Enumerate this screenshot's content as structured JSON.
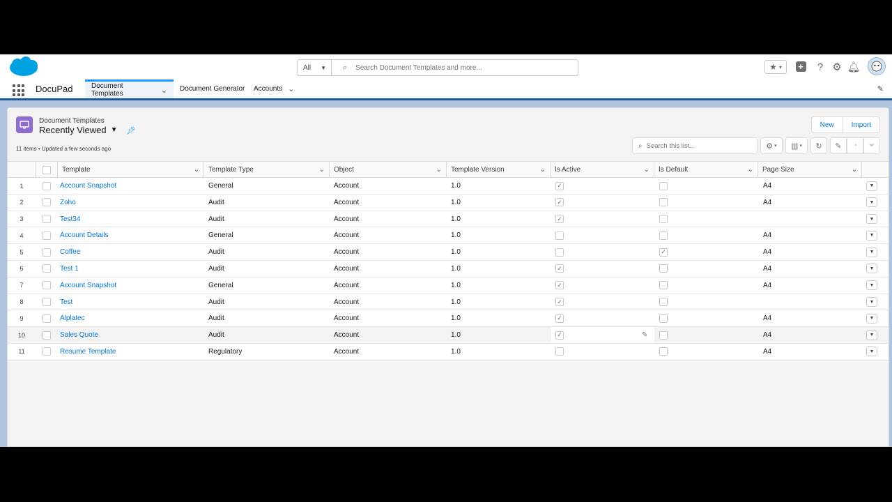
{
  "search": {
    "scope": "All",
    "placeholder": "Search Document Templates and more..."
  },
  "nav": {
    "app_name": "DocuPad",
    "tabs": [
      {
        "label": "Document Templates",
        "active": true
      },
      {
        "label": "Document Generator",
        "active": false
      },
      {
        "label": "Accounts",
        "active": false
      }
    ]
  },
  "list": {
    "object_label": "Document Templates",
    "view_name": "Recently Viewed",
    "meta": "11 items • Updated a few seconds ago",
    "search_placeholder": "Search this list...",
    "buttons": {
      "new": "New",
      "import": "Import"
    },
    "columns": [
      "Template",
      "Template Type",
      "Object",
      "Template Version",
      "Is Active",
      "Is Default",
      "Page Size"
    ],
    "rows": [
      {
        "n": "1",
        "template": "Account Snapshot",
        "type": "General",
        "object": "Account",
        "version": "1.0",
        "active": true,
        "default": false,
        "size": "A4"
      },
      {
        "n": "2",
        "template": "Zoho",
        "type": "Audit",
        "object": "Account",
        "version": "1.0",
        "active": true,
        "default": false,
        "size": "A4"
      },
      {
        "n": "3",
        "template": "Test34",
        "type": "Audit",
        "object": "Account",
        "version": "1.0",
        "active": true,
        "default": false,
        "size": ""
      },
      {
        "n": "4",
        "template": "Account Details",
        "type": "General",
        "object": "Account",
        "version": "1.0",
        "active": false,
        "default": false,
        "size": "A4"
      },
      {
        "n": "5",
        "template": "Coffee",
        "type": "Audit",
        "object": "Account",
        "version": "1.0",
        "active": false,
        "default": true,
        "size": "A4"
      },
      {
        "n": "6",
        "template": "Test 1",
        "type": "Audit",
        "object": "Account",
        "version": "1.0",
        "active": true,
        "default": false,
        "size": "A4"
      },
      {
        "n": "7",
        "template": "Account Snapshot",
        "type": "General",
        "object": "Account",
        "version": "1.0",
        "active": true,
        "default": false,
        "size": "A4"
      },
      {
        "n": "8",
        "template": "Test",
        "type": "Audit",
        "object": "Account",
        "version": "1.0",
        "active": true,
        "default": false,
        "size": ""
      },
      {
        "n": "9",
        "template": "Alplatec",
        "type": "Audit",
        "object": "Account",
        "version": "1.0",
        "active": true,
        "default": false,
        "size": "A4"
      },
      {
        "n": "10",
        "template": "Sales Quote",
        "type": "Audit",
        "object": "Account",
        "version": "1.0",
        "active": true,
        "default": false,
        "size": "A4"
      },
      {
        "n": "11",
        "template": "Resume Template",
        "type": "Regulatory",
        "object": "Account",
        "version": "1.0",
        "active": false,
        "default": false,
        "size": "A4"
      }
    ]
  },
  "colors": {
    "accent": "#0176d3",
    "brand": "#00a1e0",
    "object_icon": "#8e6bcf",
    "nav_border": "#1b5a9c"
  }
}
